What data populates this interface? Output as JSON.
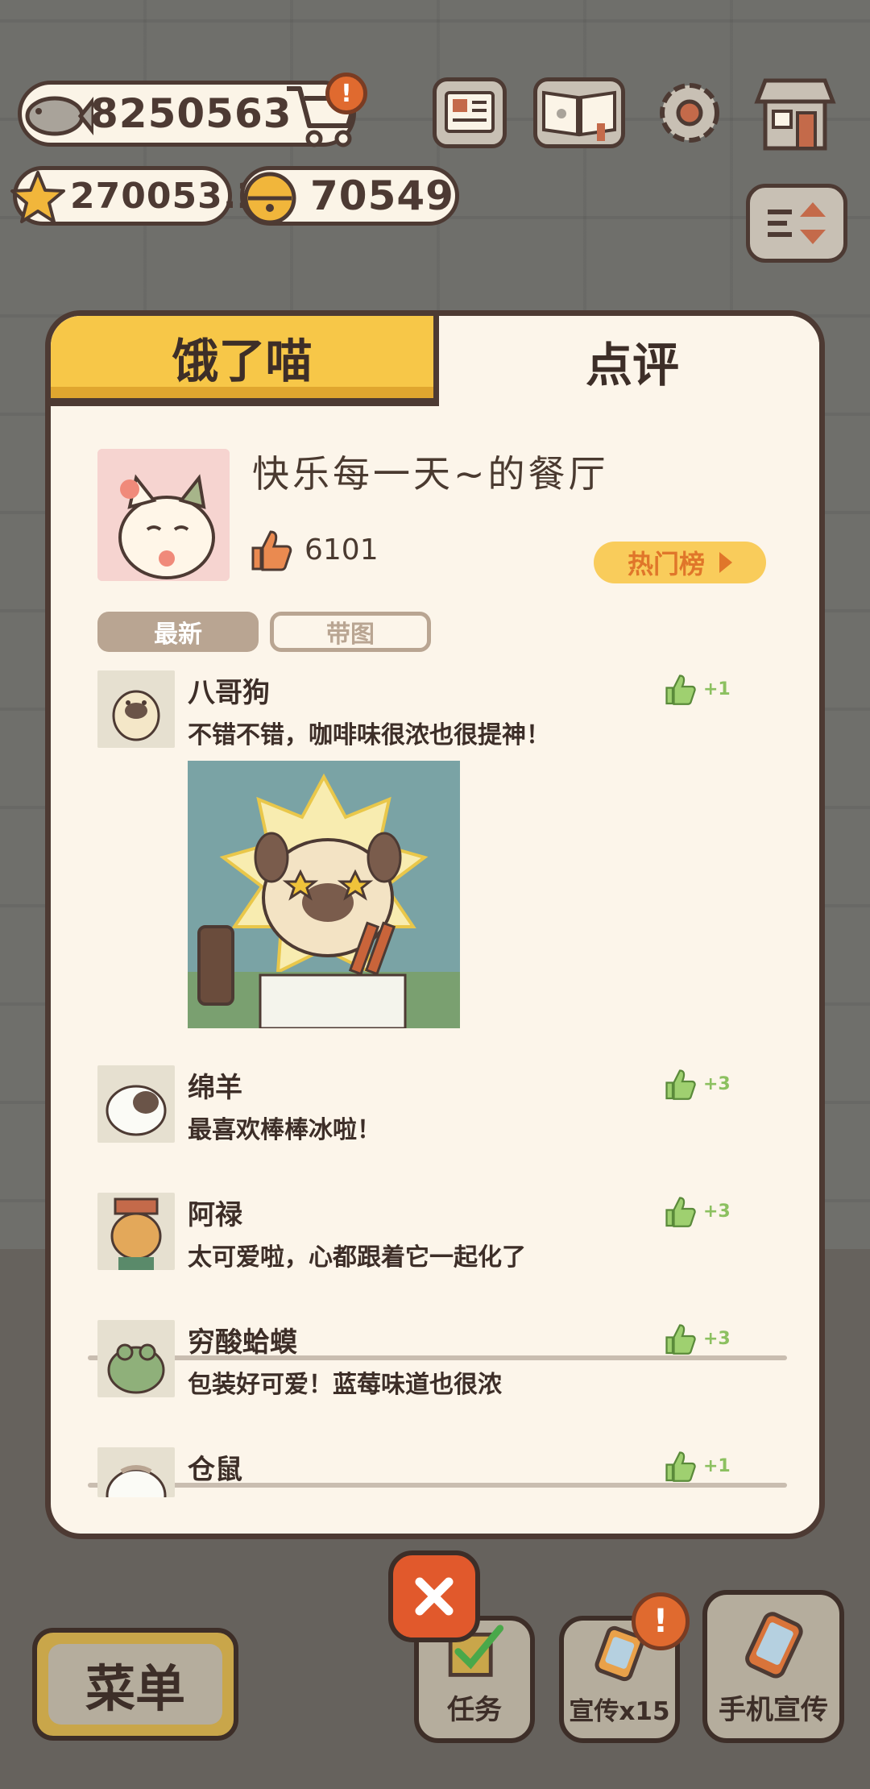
{
  "hud": {
    "fish_count": "8250563",
    "star_count": "270053.2",
    "bell_count": "70549"
  },
  "tabs": [
    {
      "label": "饿了喵",
      "active": false
    },
    {
      "label": "点评",
      "active": true
    }
  ],
  "restaurant": {
    "name": "快乐每一天~的餐厅",
    "likes": "6101",
    "hot_list_label": "热门榜"
  },
  "filters": {
    "latest": "最新",
    "with_picture": "带图"
  },
  "reviews": [
    {
      "name": "八哥狗",
      "text": "不错不错，咖啡味很浓也很提神！",
      "likes": "+1",
      "has_photo": true
    },
    {
      "name": "绵羊",
      "text": "最喜欢棒棒冰啦！",
      "likes": "+3",
      "has_photo": false
    },
    {
      "name": "阿禄",
      "text": "太可爱啦，心都跟着它一起化了",
      "likes": "+3",
      "has_photo": false
    },
    {
      "name": "穷酸蛤蟆",
      "text": "包装好可爱！蓝莓味道也很浓",
      "likes": "+3",
      "has_photo": false
    },
    {
      "name": "仓鼠",
      "text": "",
      "likes": "+1",
      "has_photo": false
    }
  ],
  "bottom_bar": {
    "menu_label": "菜单",
    "task_label": "任务",
    "promo_label": "宣传x15",
    "phone_promo_label": "手机宣传",
    "alert_mark": "!"
  },
  "colors": {
    "tab_active_bg": "#fcf5ea",
    "tab_hungry_bg": "#f7c748",
    "outline": "#4d3a33",
    "like_green": "#8cc060",
    "hot_orange": "#e0762a",
    "close_red": "#e1592c"
  }
}
